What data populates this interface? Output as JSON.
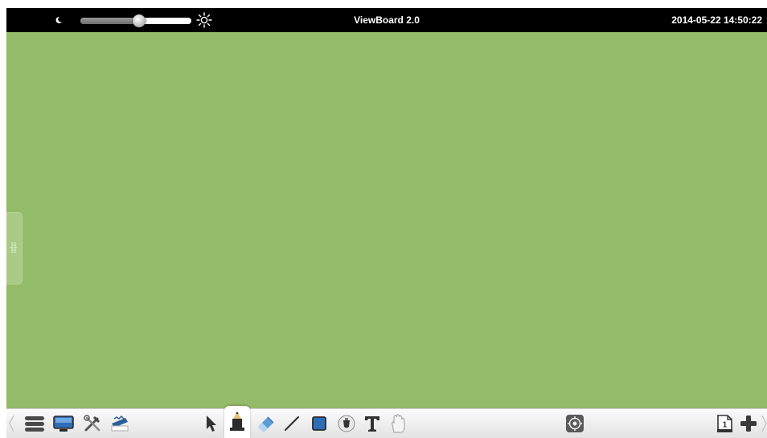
{
  "window": {
    "title": "ViewBoard 2.0",
    "datetime": "2014-05-22 14:50:22",
    "canvas_color": "#94bb68",
    "titlebar_color": "#000000"
  },
  "brightness": {
    "level": 0.53,
    "min_icon": "moon-icon",
    "max_icon": "sun-icon"
  },
  "side_panel": {
    "handle_icon": "grip-icon"
  },
  "toolbar": {
    "left": [
      "collapse-chevron-icon",
      "menu-icon",
      "monitor-icon",
      "tools-icon",
      "whiteboard-icon"
    ],
    "center": [
      "select-arrow-icon",
      "pen-icon",
      "eraser-icon",
      "line-icon",
      "rectangle-icon",
      "fill-icon",
      "text-icon",
      "hand-icon"
    ],
    "active_tool": "pen-icon",
    "right_center": [
      "screen-capture-icon"
    ],
    "page_number": "1",
    "right": [
      "page-icon",
      "add-page-icon",
      "expand-chevron-icon"
    ]
  }
}
